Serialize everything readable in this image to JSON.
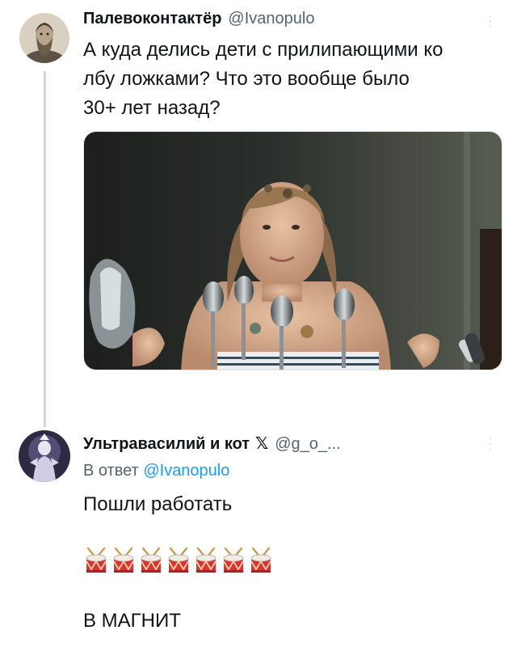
{
  "tweet1": {
    "author_name": "Палевоконтактёр",
    "author_handle": "@Ivanopulo",
    "text_lines": [
      "А куда делись дети с прилипающими ко",
      "лбу ложками? Что это вообще было",
      "30+ лет назад?"
    ],
    "avatar_icon": "bearded-man-portrait-icon",
    "more_icon": "more-options-icon",
    "media_icon": "girl-with-spoons-photo-icon"
  },
  "tweet2": {
    "author_name": "Ультравасилий и кот",
    "author_badge": "𝕏",
    "author_handle": "@g_o_...",
    "reply_prefix": "В ответ",
    "reply_handle": "@Ivanopulo",
    "text_line1": "Пошли работать",
    "drum_emoji_count": 7,
    "text_line2": "В МАГНИТ",
    "avatar_icon": "glowing-figure-avatar-icon",
    "drum_icon": "drum-emoji-icon"
  },
  "colors": {
    "link": "#1d9bf0",
    "secondary_text": "#536471",
    "thread_line": "#cfd9de"
  }
}
